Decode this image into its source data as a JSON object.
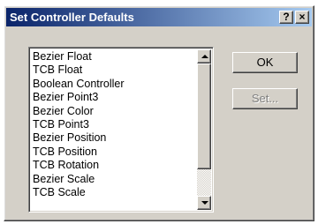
{
  "window": {
    "title": "Set Controller Defaults",
    "help_label": "?",
    "close_label": "×"
  },
  "list": {
    "items": [
      "Bezier Float",
      "TCB Float",
      "Boolean Controller",
      "Bezier Point3",
      "Bezier Color",
      "TCB Point3",
      "Bezier Position",
      "TCB Position",
      "TCB Rotation",
      "Bezier Scale",
      "TCB Scale"
    ]
  },
  "buttons": {
    "ok_label": "OK",
    "set_label": "Set..."
  }
}
